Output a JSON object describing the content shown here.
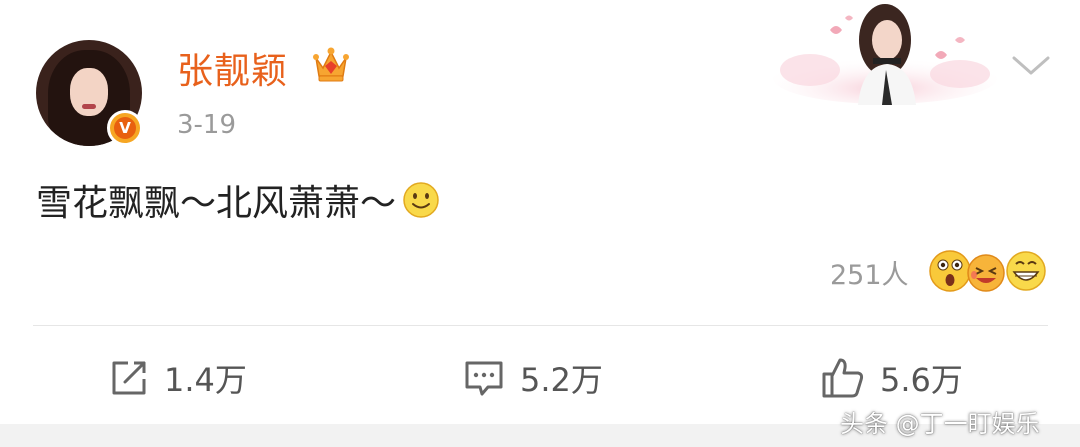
{
  "user": {
    "name": "张靓颖",
    "date": "3-19",
    "verified_badge": "V"
  },
  "post": {
    "text": "雪花飘飘～北风萧萧～",
    "emoji": "smile-emoji"
  },
  "reactions": {
    "count": "251人",
    "emojis": [
      "surprised-emoji",
      "laugh-cry-emoji",
      "grin-emoji"
    ]
  },
  "actions": {
    "share_count": "1.4万",
    "comment_count": "5.2万",
    "like_count": "5.6万"
  },
  "watermark": "头条 @丁一盯娱乐",
  "colors": {
    "name": "#e8611c",
    "badge": "#f6a623",
    "muted": "#9a9a9a",
    "text": "#222222"
  }
}
